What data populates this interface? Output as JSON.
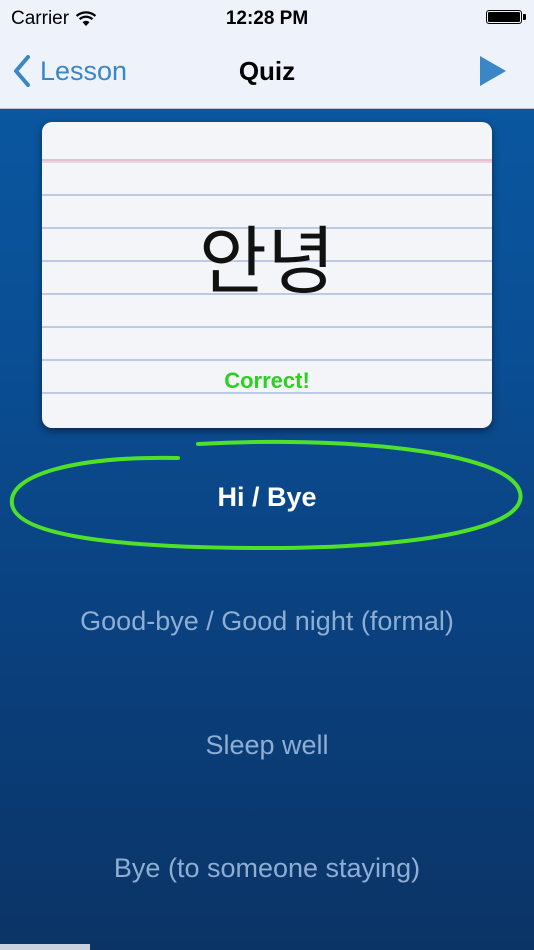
{
  "status_bar": {
    "carrier": "Carrier",
    "time": "12:28 PM",
    "wifi_icon": "wifi-icon",
    "battery_icon": "battery-icon"
  },
  "nav": {
    "back_label": "Lesson",
    "title": "Quiz",
    "back_icon": "chevron-left-icon",
    "play_icon": "play-icon"
  },
  "card": {
    "word": "안녕",
    "result": "Correct!"
  },
  "options": [
    {
      "label": "Hi / Bye",
      "selected": true
    },
    {
      "label": "Good-bye / Good night (formal)",
      "selected": false
    },
    {
      "label": "Sleep well",
      "selected": false
    },
    {
      "label": "Bye (to someone staying)",
      "selected": false
    }
  ],
  "colors": {
    "accent": "#3a86c6",
    "correct": "#2ad11f",
    "background": "#0a4f95",
    "option_inactive": "#8eaed4",
    "selection_circle": "#4fe02a"
  }
}
